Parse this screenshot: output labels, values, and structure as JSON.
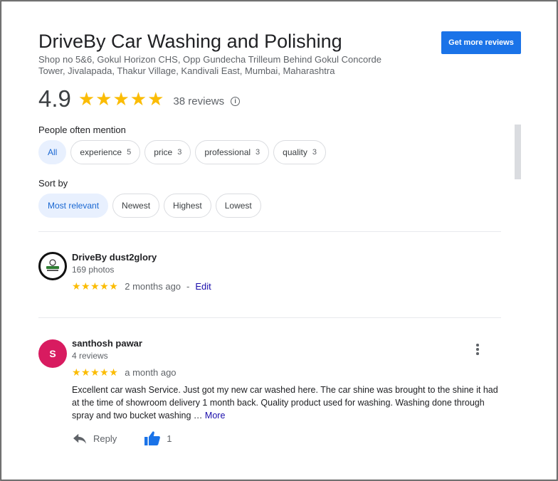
{
  "business": {
    "name": "DriveBy Car Washing and Polishing",
    "address": "Shop no 5&6, Gokul Horizon CHS, Opp Gundecha Trilleum Behind Gokul Concorde Tower, Jivalapada, Thakur Village, Kandivali East, Mumbai, Maharashtra",
    "get_reviews_label": "Get more reviews",
    "rating": "4.9",
    "stars": "★★★★★",
    "review_count": "38 reviews",
    "info_glyph": "i"
  },
  "mentions": {
    "label": "People often mention",
    "chips": [
      {
        "label": "All",
        "count": ""
      },
      {
        "label": "experience",
        "count": "5"
      },
      {
        "label": "price",
        "count": "3"
      },
      {
        "label": "professional",
        "count": "3"
      },
      {
        "label": "quality",
        "count": "3"
      }
    ]
  },
  "sort": {
    "label": "Sort by",
    "options": [
      "Most relevant",
      "Newest",
      "Highest",
      "Lowest"
    ]
  },
  "reviews": [
    {
      "name": "DriveBy dust2glory",
      "sub": "169 photos",
      "stars": "★★★★★",
      "time": "2 months ago",
      "separator": "-",
      "edit": "Edit"
    },
    {
      "avatar_letter": "S",
      "name": "santhosh pawar",
      "sub": "4 reviews",
      "stars": "★★★★★",
      "time": "a month ago",
      "text": "Excellent car wash Service. Just got my new car washed here. The car shine was brought to the shine it had at the time of showroom delivery 1 month back. Quality product used for washing. Washing done through spray and two bucket washing …",
      "more": "More",
      "reply": "Reply",
      "likes": "1"
    }
  ],
  "colors": {
    "accent": "#1a73e8",
    "star": "#fbbc04",
    "chip_selected_bg": "#e8f0fe",
    "avatar_s": "#d81b60"
  },
  "icons": [
    "info-icon",
    "reply-icon",
    "thumbs-up-icon",
    "more-vert-icon"
  ]
}
